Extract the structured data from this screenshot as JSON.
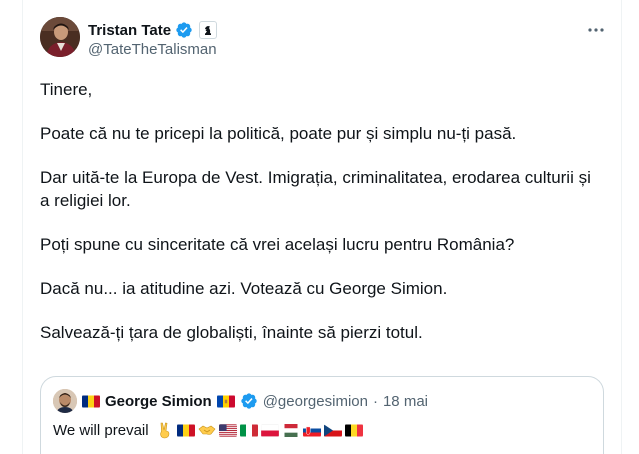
{
  "tweet": {
    "author": {
      "display_name": "Tristan Tate",
      "handle": "@TateTheTalisman",
      "verified": true,
      "affiliate_badge_icon": "chess-knight-icon"
    },
    "more_icon": "more-options-icon",
    "paragraphs": [
      "Tinere,",
      "Poate că nu te pricepi la politică, poate pur și simplu nu-ți pasă.",
      "Dar uită-te la Europa de Vest. Imigrația, criminalitatea, erodarea culturii și a religiei lor.",
      "Poți spune cu sinceritate că vrei același lucru pentru România?",
      "Dacă nu... ia atitudine azi. Votează cu George Simion.",
      "Salvează-ți țara de globaliști, înainte să pierzi totul."
    ]
  },
  "quote": {
    "author": {
      "display_name": "George Simion",
      "handle": "@georgesimion",
      "verified": true,
      "name_prefix_flag": "romania-flag",
      "name_suffix_flag": "moldova-flag"
    },
    "separator": "·",
    "date": "18 mai",
    "text": "We will prevail",
    "emojis": [
      "victory-hand-icon",
      "romania-flag",
      "handshake-icon",
      "usa-flag",
      "italy-flag",
      "poland-flag",
      "hungary-flag",
      "slovakia-flag",
      "czechia-flag",
      "belgium-flag"
    ]
  },
  "colors": {
    "text_primary": "#0f1419",
    "text_secondary": "#536471",
    "verified_blue": "#1d9bf0",
    "border": "#cfd9de"
  }
}
